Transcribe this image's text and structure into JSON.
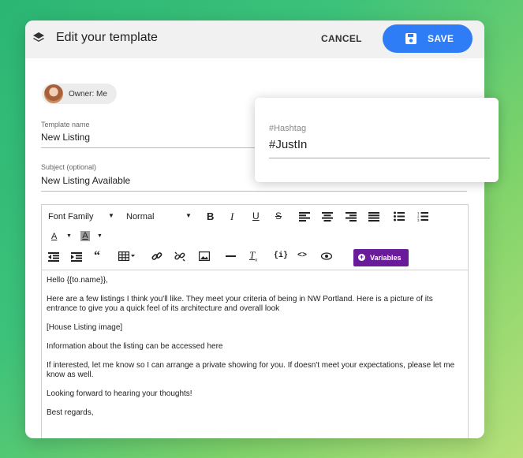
{
  "header": {
    "title": "Edit your template",
    "cancel_label": "CANCEL",
    "save_label": "SAVE"
  },
  "owner": {
    "label": "Owner: Me"
  },
  "fields": {
    "template_name": {
      "label": "Template name",
      "value": "New Listing"
    },
    "subject": {
      "label": "Subject (optional)",
      "value": "New Listing Available"
    },
    "hashtag": {
      "label": "#Hashtag",
      "value": "#JustIn"
    }
  },
  "toolbar": {
    "font_family": "Font Family",
    "font_size": "Normal",
    "variables_label": "Variables"
  },
  "body": {
    "greeting": "Hello {{to.name}},",
    "para1": "Here are a few listings I think you'll like. They meet your criteria of being in NW Portland. Here is a picture of its entrance to give you a quick feel of its architecture and overall look",
    "para2": "[House Listing image]",
    "para3": "Information about the listing can be accessed here",
    "para4": "If interested, let me know so I can arrange a private showing for you. If doesn't meet your expectations, please let me know as well.",
    "para5": "Looking forward to hearing your thoughts!",
    "closing": "Best regards,"
  },
  "colors": {
    "accent": "#2e7cf6",
    "variables": "#6a1b9a"
  }
}
